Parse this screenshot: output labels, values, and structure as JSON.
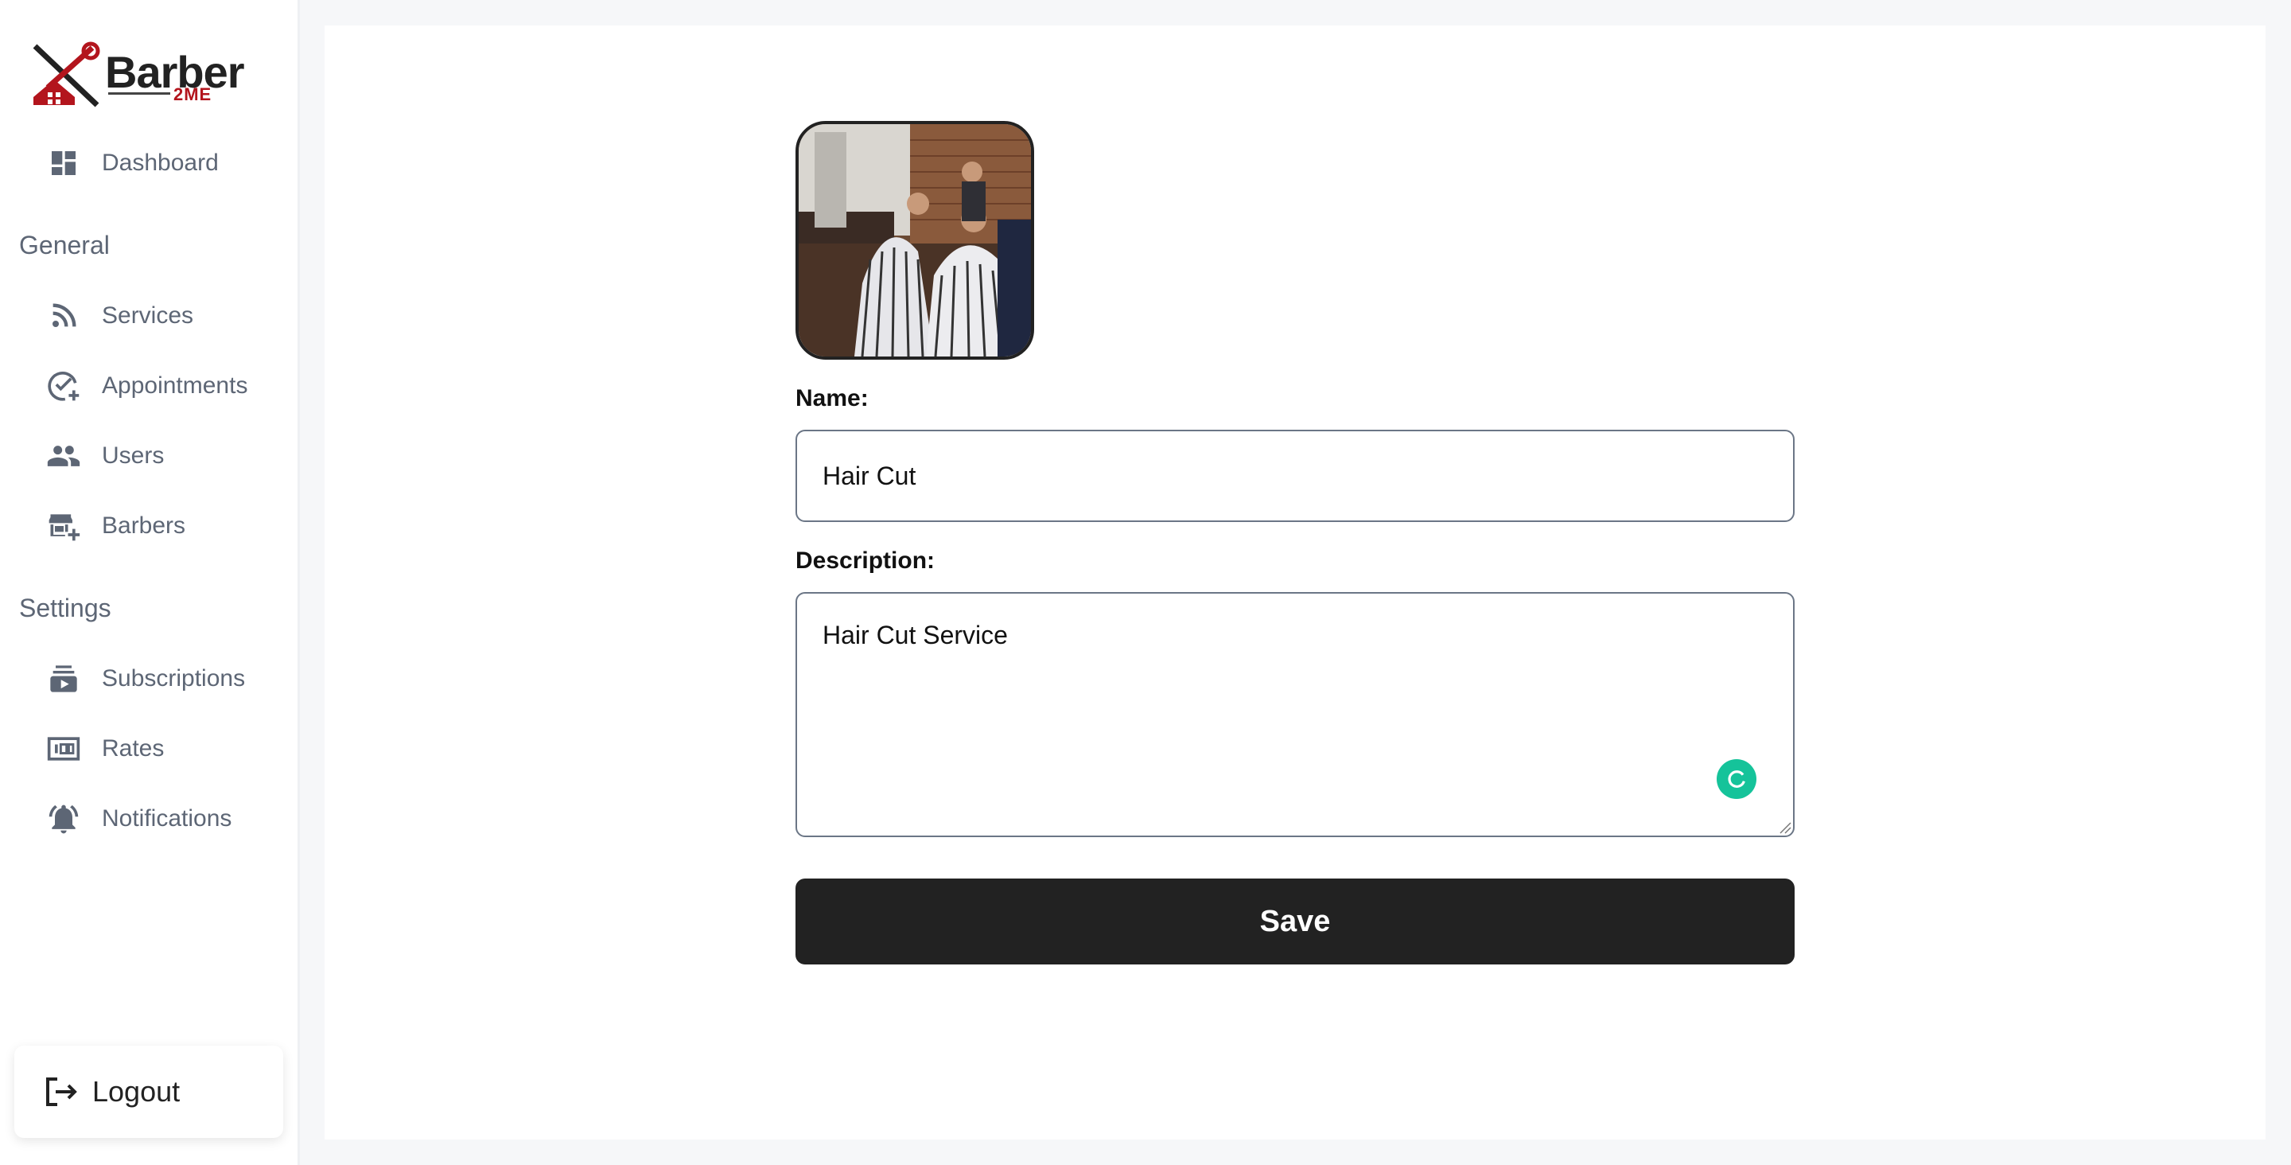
{
  "brand": {
    "name": "Barber",
    "sub": "2ME"
  },
  "sidebar": {
    "dashboard": "Dashboard",
    "section_general": "General",
    "section_settings": "Settings",
    "items": [
      {
        "label": "Services",
        "icon": "rss-icon"
      },
      {
        "label": "Appointments",
        "icon": "check-add-icon"
      },
      {
        "label": "Users",
        "icon": "users-icon"
      },
      {
        "label": "Barbers",
        "icon": "store-add-icon"
      },
      {
        "label": "Subscriptions",
        "icon": "subscriptions-icon"
      },
      {
        "label": "Rates",
        "icon": "rates-icon"
      },
      {
        "label": "Notifications",
        "icon": "bell-icon"
      }
    ],
    "logout": "Logout"
  },
  "form": {
    "name_label": "Name:",
    "name_value": "Hair Cut",
    "description_label": "Description:",
    "description_value": "Hair Cut Service",
    "save_label": "Save"
  },
  "colors": {
    "accent_red": "#b3151d",
    "save_button": "#222222",
    "grammarly": "#15c39a"
  }
}
